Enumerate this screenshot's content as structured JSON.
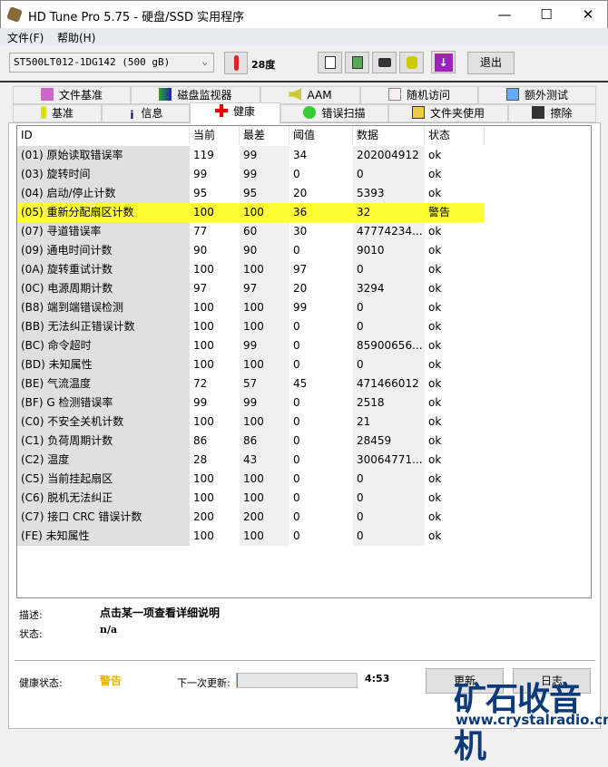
{
  "window": {
    "title": "HD Tune Pro 5.75 - 硬盘/SSD 实用程序",
    "minimize": "—",
    "maximize": "☐",
    "close": "✕"
  },
  "menu": [
    "文件(F)",
    "帮助(H)"
  ],
  "toolbar": {
    "drive": "ST500LT012-1DG142 (500 gB)",
    "temperature": "28度",
    "exit": "退出"
  },
  "tabs_top": [
    "文件基准",
    "磁盘监视器",
    "AAM",
    "随机访问",
    "额外测试"
  ],
  "tabs_bottom": [
    "基准",
    "信息",
    "健康",
    "错误扫描",
    "文件夹使用",
    "擦除"
  ],
  "table": {
    "headers": [
      "ID",
      "当前",
      "最差",
      "阈值",
      "数据",
      "状态"
    ],
    "rows": [
      [
        "(01) 原始读取错误率",
        "119",
        "99",
        "34",
        "202004912",
        "ok"
      ],
      [
        "(03) 旋转时间",
        "99",
        "99",
        "0",
        "0",
        "ok"
      ],
      [
        "(04) 启动/停止计数",
        "95",
        "95",
        "20",
        "5393",
        "ok"
      ],
      [
        "(05) 重新分配扇区计数",
        "100",
        "100",
        "36",
        "32",
        "警告"
      ],
      [
        "(07) 寻道错误率",
        "77",
        "60",
        "30",
        "47774234...",
        "ok"
      ],
      [
        "(09) 通电时间计数",
        "90",
        "90",
        "0",
        "9010",
        "ok"
      ],
      [
        "(0A) 旋转重试计数",
        "100",
        "100",
        "97",
        "0",
        "ok"
      ],
      [
        "(0C) 电源周期计数",
        "97",
        "97",
        "20",
        "3294",
        "ok"
      ],
      [
        "(B8) 端到端错误检测",
        "100",
        "100",
        "99",
        "0",
        "ok"
      ],
      [
        "(BB) 无法纠正错误计数",
        "100",
        "100",
        "0",
        "0",
        "ok"
      ],
      [
        "(BC) 命令超时",
        "100",
        "99",
        "0",
        "85900656...",
        "ok"
      ],
      [
        "(BD) 未知属性",
        "100",
        "100",
        "0",
        "0",
        "ok"
      ],
      [
        "(BE) 气流温度",
        "72",
        "57",
        "45",
        "471466012",
        "ok"
      ],
      [
        "(BF) G 检测错误率",
        "99",
        "99",
        "0",
        "2518",
        "ok"
      ],
      [
        "(C0) 不安全关机计数",
        "100",
        "100",
        "0",
        "21",
        "ok"
      ],
      [
        "(C1) 负荷周期计数",
        "86",
        "86",
        "0",
        "28459",
        "ok"
      ],
      [
        "(C2) 温度",
        "28",
        "43",
        "0",
        "30064771...",
        "ok"
      ],
      [
        "(C5) 当前挂起扇区",
        "100",
        "100",
        "0",
        "0",
        "ok"
      ],
      [
        "(C6) 脱机无法纠正",
        "100",
        "100",
        "0",
        "0",
        "ok"
      ],
      [
        "(C7) 接口 CRC 错误计数",
        "200",
        "200",
        "0",
        "0",
        "ok"
      ],
      [
        "(FE) 未知属性",
        "100",
        "100",
        "0",
        "0",
        "ok"
      ]
    ],
    "highlight_row": 3,
    "highlight_color": "#ffff33"
  },
  "details": {
    "desc_label": "描述:",
    "desc_value": "点击某一项查看详细说明",
    "status_label": "状态:",
    "status_value": "n/a"
  },
  "footer": {
    "health_label": "健康状态:",
    "health_value": "警告",
    "health_color": "#e6b800",
    "next_label": "下一次更新:",
    "countdown": "4:53",
    "progress": 0.01,
    "refresh": "更新",
    "log": "日志"
  },
  "watermark": {
    "text": "矿石收音机",
    "url": "www.crystalradio.cn"
  }
}
